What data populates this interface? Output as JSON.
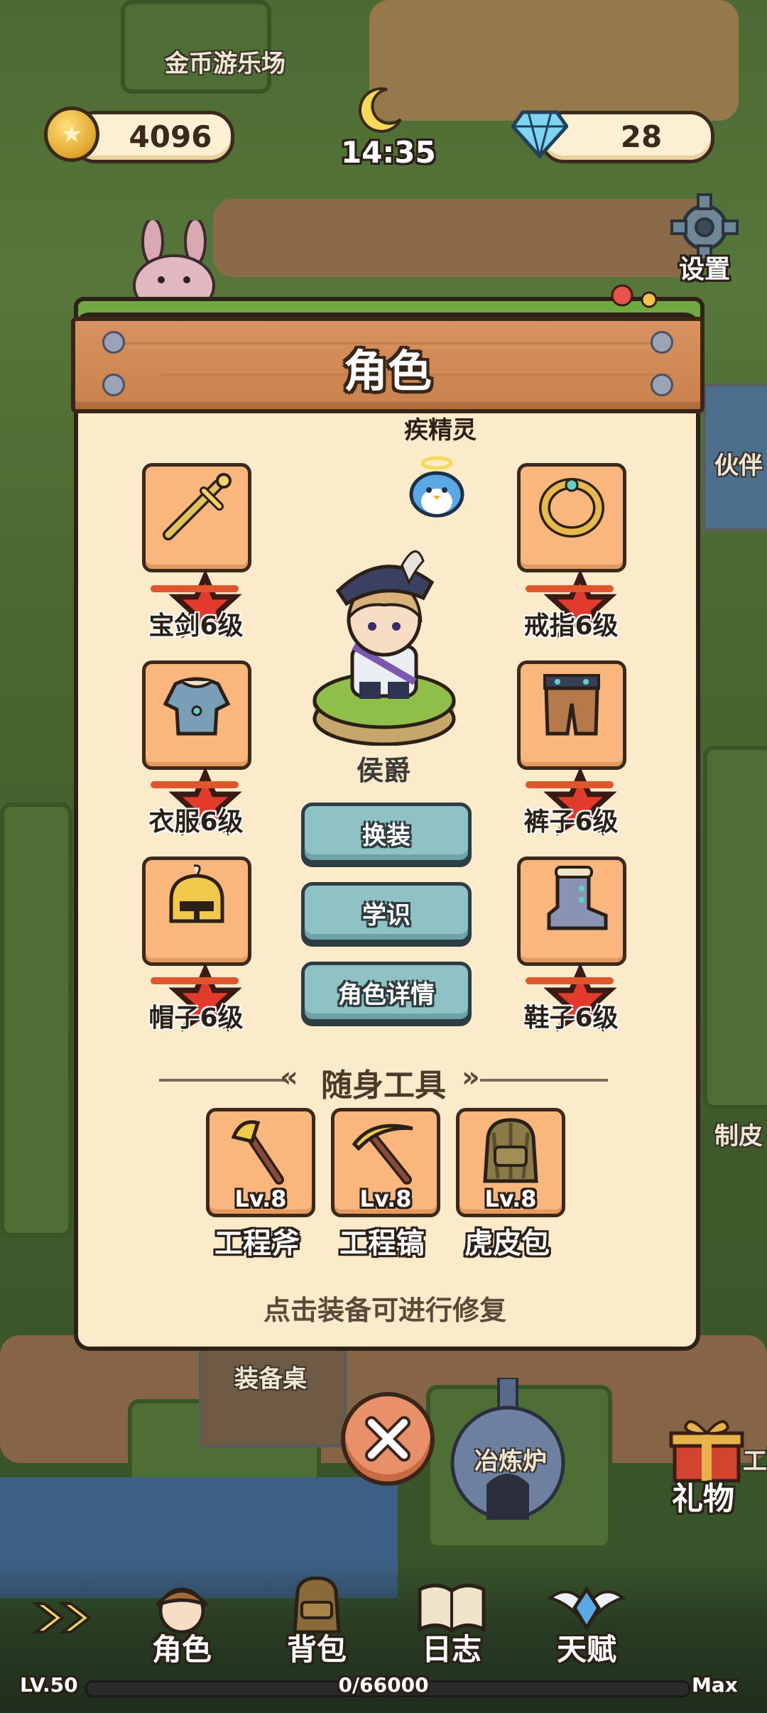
{
  "hud": {
    "location": "金币游乐场",
    "coins": "4096",
    "time": "14:35",
    "gems": "28",
    "settings_label": "设置"
  },
  "map_labels": {
    "partner": "伙伴",
    "craft": "制皮",
    "equip_table": "装备桌",
    "furnace": "冶炼炉",
    "gift": "礼物",
    "work": "工"
  },
  "panel": {
    "title": "角色",
    "pet_name": "疾精灵",
    "character_title": "侯爵",
    "equipment": [
      {
        "name": "宝剑6级",
        "icon": "sword-icon",
        "stars": 3
      },
      {
        "name": "戒指6级",
        "icon": "ring-icon",
        "stars": 3
      },
      {
        "name": "衣服6级",
        "icon": "armor-icon",
        "stars": 3
      },
      {
        "name": "裤子6级",
        "icon": "pants-icon",
        "stars": 3
      },
      {
        "name": "帽子6级",
        "icon": "helmet-icon",
        "stars": 3
      },
      {
        "name": "鞋子6级",
        "icon": "boots-icon",
        "stars": 3
      }
    ],
    "buttons": {
      "change": "换装",
      "knowledge": "学识",
      "details": "角色详情"
    },
    "tools_header": "随身工具",
    "tools": [
      {
        "name": "工程斧",
        "level": "Lv.8",
        "icon": "axe-icon"
      },
      {
        "name": "工程镐",
        "level": "Lv.8",
        "icon": "pickaxe-icon"
      },
      {
        "name": "虎皮包",
        "level": "Lv.8",
        "icon": "backpack-icon"
      }
    ],
    "hint": "点击装备可进行修复"
  },
  "bottom_nav": {
    "items": [
      {
        "label": "角色",
        "icon": "character-icon"
      },
      {
        "label": "背包",
        "icon": "backpack-icon"
      },
      {
        "label": "日志",
        "icon": "journal-icon"
      },
      {
        "label": "天赋",
        "icon": "talent-icon"
      }
    ],
    "level": "LV.50",
    "xp": "0/66000",
    "max": "Max"
  },
  "colors": {
    "panel_bg": "#fcebcb",
    "slot_bg": "#f9b67d",
    "button_bg": "#8fc2c5",
    "accent_red": "#e0552c",
    "banner": "#d08a56"
  }
}
